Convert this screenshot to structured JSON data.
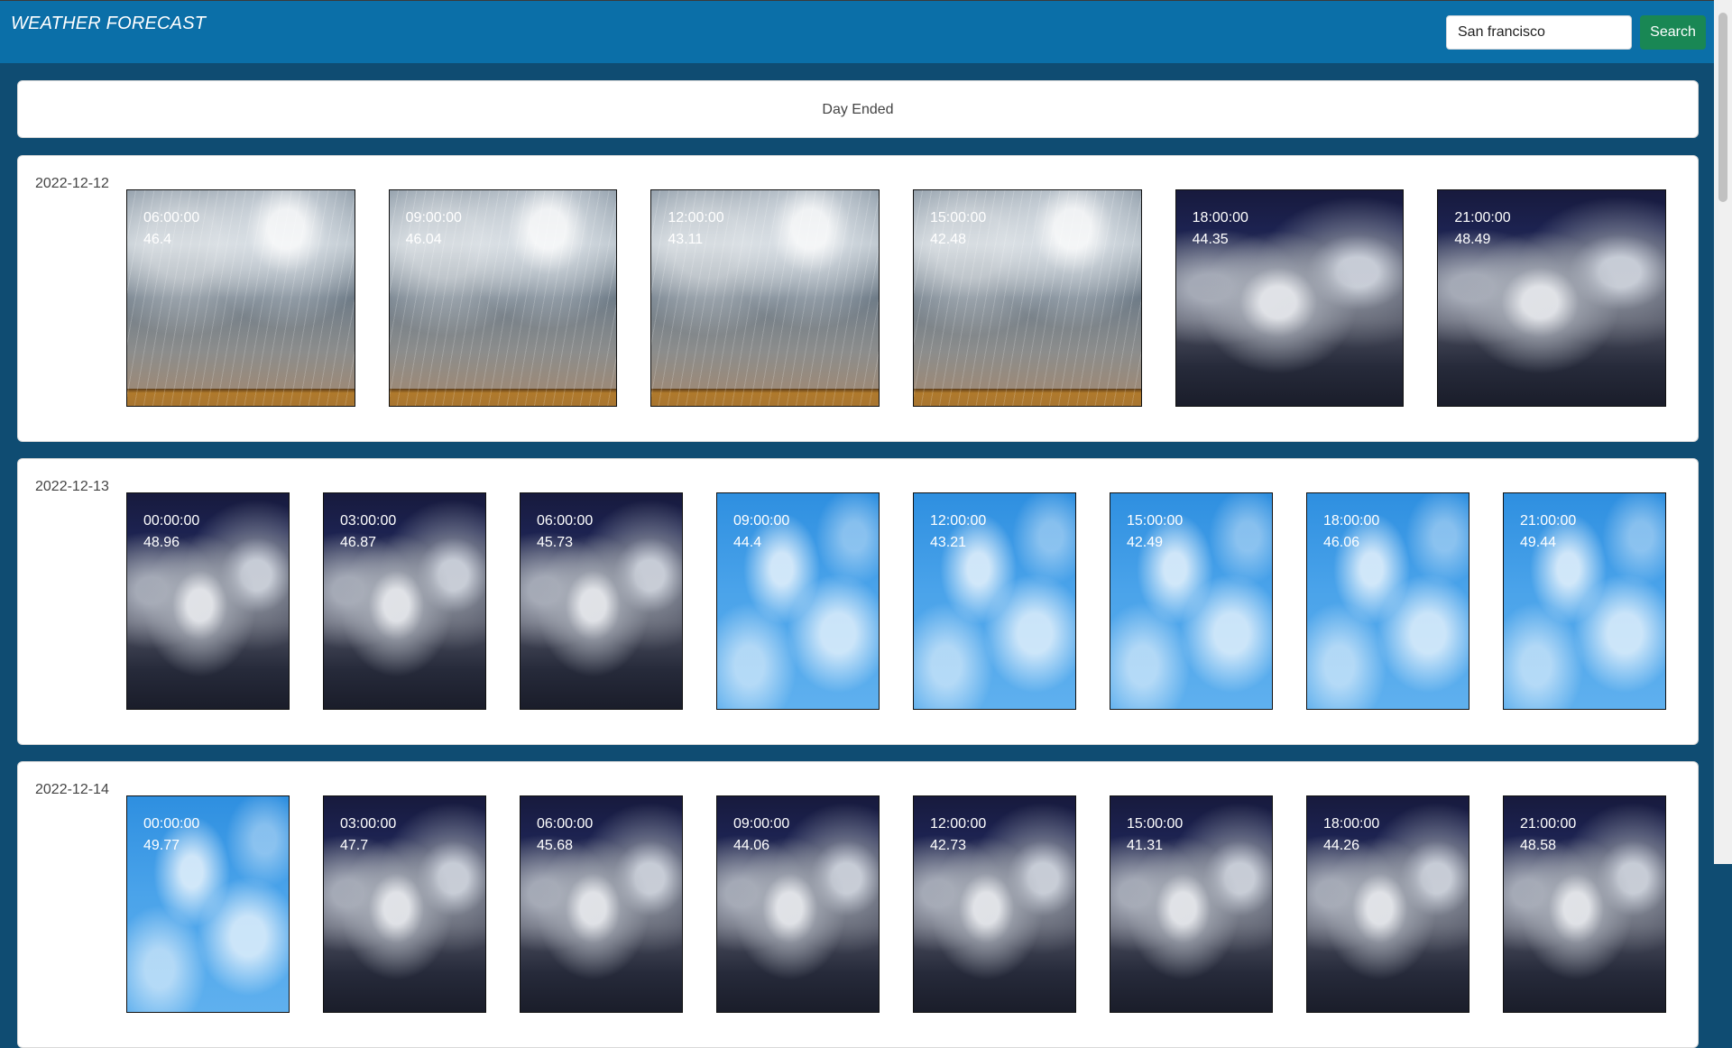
{
  "header": {
    "brand": "WEATHER FORECAST",
    "search_value": "San francisco",
    "search_button": "Search"
  },
  "status": "Day Ended",
  "days": [
    {
      "date": "2022-12-12",
      "forecasts": [
        {
          "time": "06:00:00",
          "temp": "46.4",
          "condition": "rain"
        },
        {
          "time": "09:00:00",
          "temp": "46.04",
          "condition": "rain"
        },
        {
          "time": "12:00:00",
          "temp": "43.11",
          "condition": "rain"
        },
        {
          "time": "15:00:00",
          "temp": "42.48",
          "condition": "rain"
        },
        {
          "time": "18:00:00",
          "temp": "44.35",
          "condition": "clouds"
        },
        {
          "time": "21:00:00",
          "temp": "48.49",
          "condition": "clouds"
        }
      ]
    },
    {
      "date": "2022-12-13",
      "forecasts": [
        {
          "time": "00:00:00",
          "temp": "48.96",
          "condition": "clouds"
        },
        {
          "time": "03:00:00",
          "temp": "46.87",
          "condition": "clouds"
        },
        {
          "time": "06:00:00",
          "temp": "45.73",
          "condition": "clouds"
        },
        {
          "time": "09:00:00",
          "temp": "44.4",
          "condition": "clear"
        },
        {
          "time": "12:00:00",
          "temp": "43.21",
          "condition": "clear"
        },
        {
          "time": "15:00:00",
          "temp": "42.49",
          "condition": "clear"
        },
        {
          "time": "18:00:00",
          "temp": "46.06",
          "condition": "clear"
        },
        {
          "time": "21:00:00",
          "temp": "49.44",
          "condition": "clear"
        }
      ]
    },
    {
      "date": "2022-12-14",
      "forecasts": [
        {
          "time": "00:00:00",
          "temp": "49.77",
          "condition": "clear"
        },
        {
          "time": "03:00:00",
          "temp": "47.7",
          "condition": "clouds"
        },
        {
          "time": "06:00:00",
          "temp": "45.68",
          "condition": "clouds"
        },
        {
          "time": "09:00:00",
          "temp": "44.06",
          "condition": "clouds"
        },
        {
          "time": "12:00:00",
          "temp": "42.73",
          "condition": "clouds"
        },
        {
          "time": "15:00:00",
          "temp": "41.31",
          "condition": "clouds"
        },
        {
          "time": "18:00:00",
          "temp": "44.26",
          "condition": "clouds"
        },
        {
          "time": "21:00:00",
          "temp": "48.58",
          "condition": "clouds"
        }
      ]
    }
  ],
  "colors": {
    "page_background": "#0f4c72",
    "navbar": "#0b6fa8",
    "search_button": "#198754"
  }
}
